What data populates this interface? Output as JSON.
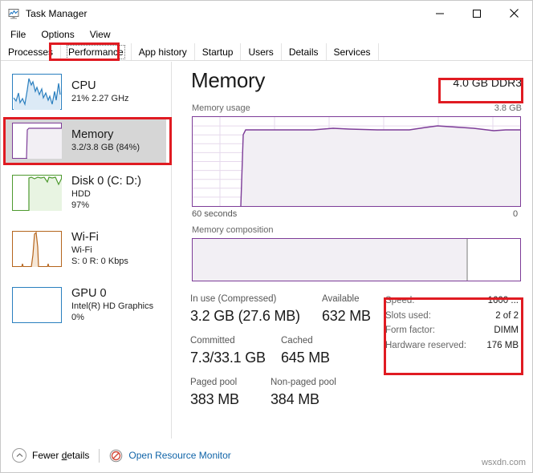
{
  "window": {
    "title": "Task Manager",
    "icon": "task-manager-icon",
    "minimize_label": "—",
    "maximize_label": "□",
    "close_label": "✕"
  },
  "menu": {
    "items": [
      {
        "label": "File"
      },
      {
        "label": "Options"
      },
      {
        "label": "View"
      }
    ]
  },
  "tabs": {
    "items": [
      {
        "label": "Processes",
        "selected": false
      },
      {
        "label": "Performance",
        "selected": true
      },
      {
        "label": "App history",
        "selected": false
      },
      {
        "label": "Startup",
        "selected": false
      },
      {
        "label": "Users",
        "selected": false
      },
      {
        "label": "Details",
        "selected": false
      },
      {
        "label": "Services",
        "selected": false
      }
    ]
  },
  "sidebar": {
    "items": [
      {
        "name": "CPU",
        "line2": "21% 2.27 GHz",
        "line3": "",
        "color": "#2a7fbf",
        "selected": false
      },
      {
        "name": "Memory",
        "line2": "3.2/3.8 GB (84%)",
        "line3": "",
        "color": "#7d3c98",
        "selected": true
      },
      {
        "name": "Disk 0 (C: D:)",
        "line2": "HDD",
        "line3": "97%",
        "color": "#4e9a2f",
        "selected": false
      },
      {
        "name": "Wi-Fi",
        "line2": "Wi-Fi",
        "line3": "S: 0 R: 0 Kbps",
        "color": "#b5651d",
        "selected": false
      },
      {
        "name": "GPU 0",
        "line2": "Intel(R) HD Graphics",
        "line3": "0%",
        "color": "#2a7fbf",
        "selected": false
      }
    ]
  },
  "detail": {
    "title": "Memory",
    "hardware": "4.0 GB DDR3",
    "usage_label": "Memory usage",
    "usage_scale_max": "3.8 GB",
    "axis_left": "60 seconds",
    "axis_right": "0",
    "composition_label": "Memory composition",
    "composition_used_percent": 84,
    "stats": [
      {
        "label": "In use (Compressed)",
        "value": "3.2 GB (27.6 MB)"
      },
      {
        "label": "Available",
        "value": "632 MB"
      },
      {
        "label": "Committed",
        "value": "7.3/33.1 GB"
      },
      {
        "label": "Cached",
        "value": "645 MB"
      },
      {
        "label": "Paged pool",
        "value": "383 MB"
      },
      {
        "label": "Non-paged pool",
        "value": "384 MB"
      }
    ],
    "info": [
      {
        "key": "Speed:",
        "value": "1600 ..."
      },
      {
        "key": "Slots used:",
        "value": "2 of 2"
      },
      {
        "key": "Form factor:",
        "value": "DIMM"
      },
      {
        "key": "Hardware reserved:",
        "value": "176 MB"
      }
    ]
  },
  "chart_data": {
    "type": "area",
    "title": "Memory usage",
    "ylabel": "GB",
    "xlabel": "seconds",
    "ylim": [
      0,
      3.8
    ],
    "xlim": [
      60,
      0
    ],
    "grid": true,
    "legend": "none",
    "line_color": "#7d3c98",
    "fill_color": "#f2eff4",
    "x": [
      60,
      55,
      50,
      45,
      42,
      41,
      40,
      35,
      30,
      25,
      22,
      20,
      18,
      15,
      10,
      8,
      6,
      5,
      3,
      1,
      0
    ],
    "values": [
      0,
      0,
      0,
      0,
      0,
      0.9,
      3.2,
      3.2,
      3.2,
      3.2,
      3.25,
      3.25,
      3.2,
      3.2,
      3.2,
      3.27,
      3.3,
      3.28,
      3.25,
      3.2,
      3.2
    ]
  },
  "statusbar": {
    "fewer_details_prefix": "Fewer ",
    "fewer_details_accel": "d",
    "fewer_details_suffix": "etails",
    "resource_monitor_label": "Open Resource Monitor",
    "collapse_icon": "chevron-up-icon",
    "resource_monitor_icon": "resource-monitor-icon"
  },
  "watermark": {
    "text": "wsxdn.com"
  },
  "colors": {
    "memory_accent": "#7d3c98",
    "annotation": "#e01b22",
    "link": "#1064a8",
    "selected_row": "#d6d6d6"
  }
}
